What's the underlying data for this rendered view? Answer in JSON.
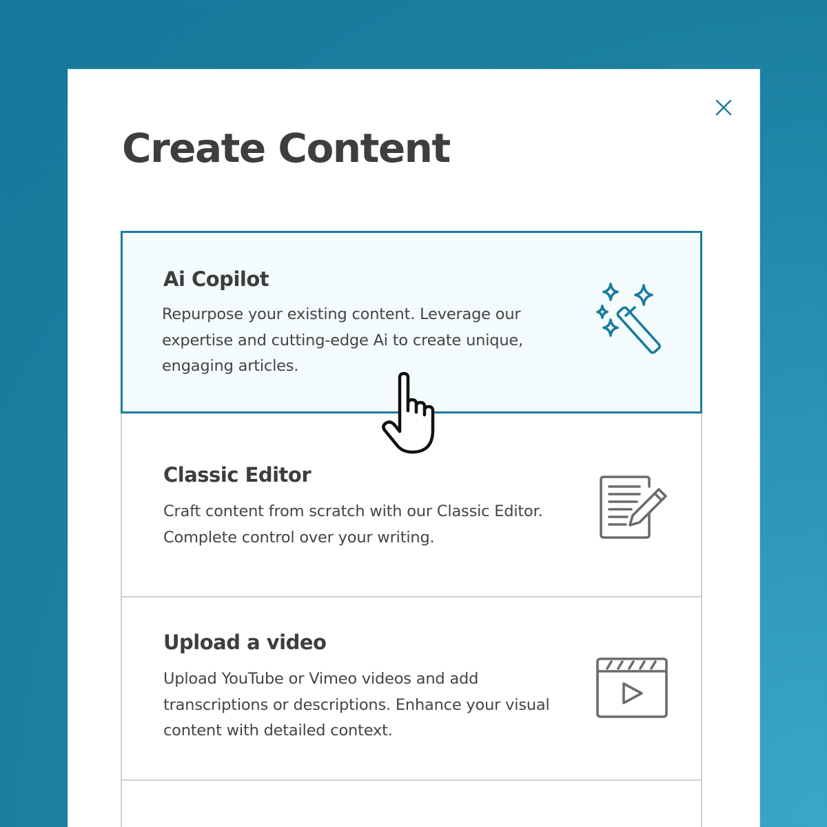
{
  "modal": {
    "title": "Create Content",
    "close_icon": "close-icon"
  },
  "options": [
    {
      "title": "Ai Copilot",
      "description": "Repurpose your existing content. Leverage our expertise and cutting-edge Ai to create unique, engaging articles.",
      "icon": "magic-wand-icon",
      "selected": true
    },
    {
      "title": "Classic Editor",
      "description": "Craft content from scratch with our Classic Editor. Complete control over your writing.",
      "icon": "document-edit-icon",
      "selected": false
    },
    {
      "title": "Upload a video",
      "description": "Upload YouTube or Vimeo videos and add transcriptions or descriptions. Enhance your visual content with detailed context.",
      "icon": "video-clapper-icon",
      "selected": false
    }
  ],
  "colors": {
    "accent": "#1a7b9c",
    "selected_bg": "#f3fbfc",
    "background": "#2a93b6",
    "title_text": "#3e3e3e",
    "icon_gray": "#6b6b6b"
  },
  "cursor_icon": "hand-pointer-icon"
}
